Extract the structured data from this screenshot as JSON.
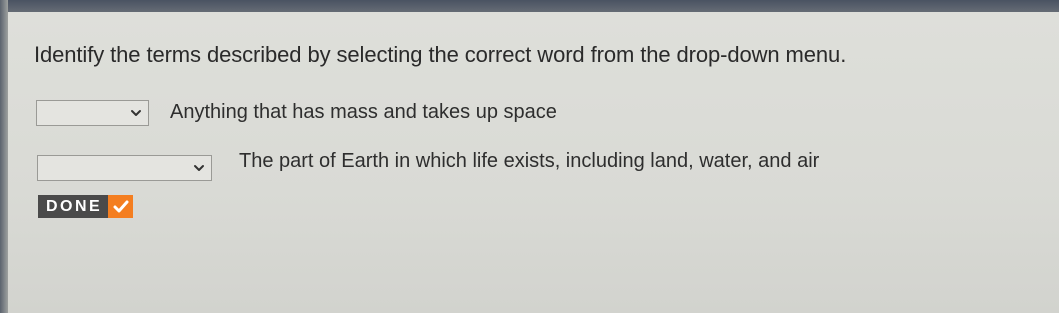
{
  "instructions": "Identify the terms described by selecting the correct word from the drop-down menu.",
  "items": [
    {
      "dropdown_value": "",
      "definition": "Anything that has mass and takes up space"
    },
    {
      "dropdown_value": "",
      "definition": "The part of Earth in which life exists, including land, water, and air"
    }
  ],
  "done_button": {
    "label": "DONE",
    "icon": "checkmark-icon"
  },
  "colors": {
    "done_bg": "#4a4a4a",
    "check_accent": "#f47e20"
  }
}
